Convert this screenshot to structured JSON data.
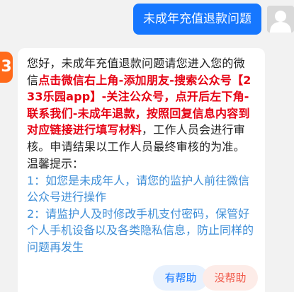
{
  "user_message": "未成年充值退款问题",
  "bot": {
    "badge": "3",
    "reply": [
      {
        "text": "您好，未成年充值退款问题请您进入您的微信",
        "highlight": false
      },
      {
        "text": "点击微信右上角-添加朋友-搜索公众号【233乐园app】-关注公众号，点开后左下角-联系我们-未成年退款，按照回复信息内容到对应链接进行填写材料",
        "highlight": true
      },
      {
        "text": "，工作人员会进行审核。申请结果以工作人员最终审核的为准。",
        "highlight": false
      }
    ],
    "tips_title": "温馨提示：",
    "tips": [
      "1：如您是未成年人，请您的监护人前往微信公众号进行操作",
      "2：请监护人及时修改手机支付密码，保管好个人手机设备以及各类隐私信息，防止同样的问题再发生"
    ]
  },
  "feedback": {
    "helpful_label": "有帮助",
    "unhelpful_label": "没帮助"
  },
  "colors": {
    "user_bubble": "#1677ff",
    "highlight_text": "#e60012",
    "tip_text": "#3f8fd8",
    "bot_badge": "#ff6a1a"
  }
}
